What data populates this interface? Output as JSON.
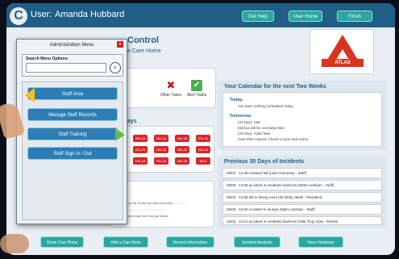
{
  "header": {
    "user_label": "User:",
    "user_name": "Amanda Hubbard",
    "buttons": [
      "Get Help",
      "User Home",
      "Finish"
    ]
  },
  "page": {
    "title": "Control",
    "subtitle": "e Care Home"
  },
  "logo": {
    "text": "C",
    "atlas_label": "ATLAS"
  },
  "tasks": [
    {
      "label": "",
      "icon": "blank"
    },
    {
      "label": "Other Tasks",
      "icon": "red-cross-icon"
    },
    {
      "label": "Alert Tasks",
      "icon": "green-check-icon"
    }
  ],
  "rota": {
    "title": "ays",
    "cells": [
      "09h-15",
      "09h-15",
      "09h-15",
      "07h-15",
      "07h-15",
      "09h-15",
      "09h-15",
      "09h-15",
      "07h-15",
      "09h-15",
      "09h-15",
      "09h-15",
      "09h-15",
      "08h-15",
      "N4-0"
    ]
  },
  "notes": [
    "(or Mr Smith (for falls from bed) ..............",
    "..........................................",
    "and wipe over lounge chairs"
  ],
  "calendar": {
    "title": "Your Calendar for the next Two Weeks",
    "today_label": "Today",
    "today_text": "You have nothing scheduled today",
    "tomorrow_label": "Tomorrow",
    "tomorrow_items": [
      "(All Day): Hair",
      "Monica will be out today 9am",
      "(All Day): Audit Task",
      "Care Plan Imports Check to print and action"
    ]
  },
  "incidents": {
    "title": "Previous 30 Days of Incidents",
    "rows": [
      "06/03 - 14:38 Assisted fall (Liam Domeney - Staff)",
      "06/03 - 14:06 accident in residents bedroom (Matt Luckham - Staff)",
      "06/03 - 12:58 fall in dining room (Mr Betty Hasel - Resident)",
      "06/03 - 12:54 Accident in lounge (Matt Luckham - Staff)",
      "15/03 - 14:12 accident in residents bedroom (Nita Ting Crisp - Reside"
    ]
  },
  "bottom_buttons": [
    "Show Care Plans",
    "Add a Care Note",
    "Record Information",
    "Incident Analysis",
    "View Handover"
  ],
  "menu": {
    "title": "Administration Menu",
    "close": "x",
    "search_label": "Search Menu Options:",
    "search_value": "",
    "search_icon": "search-icon",
    "items": [
      "Staff Area",
      "Manage Staff Records",
      "Staff Training",
      "Staff Sign In / Out"
    ]
  },
  "colors": {
    "header_bg": "#1f5f86",
    "accent_teal": "#2aa7a0",
    "menu_button": "#2c7fb5",
    "alert_red": "#d8262a"
  }
}
